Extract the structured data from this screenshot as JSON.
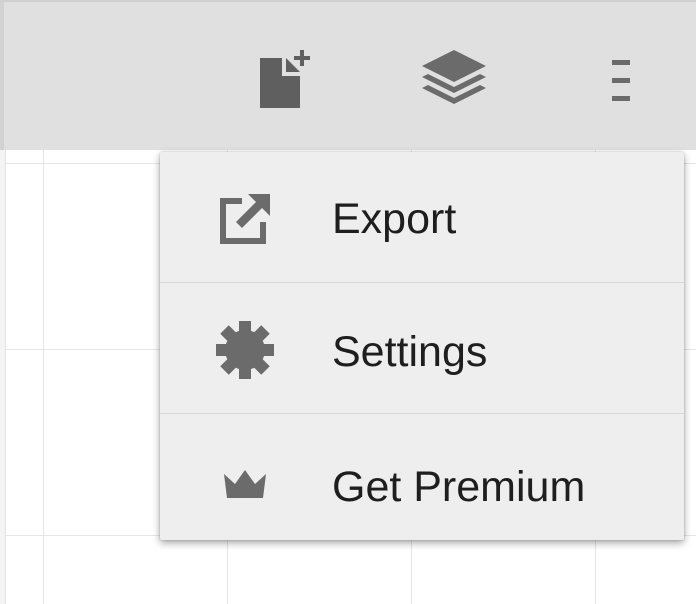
{
  "toolbar": {
    "buttons": [
      {
        "icon": "new-document-icon"
      },
      {
        "icon": "layers-icon"
      },
      {
        "icon": "overflow-menu-icon"
      }
    ]
  },
  "menu": {
    "items": [
      {
        "label": "Export",
        "icon": "export-icon"
      },
      {
        "label": "Settings",
        "icon": "gear-icon"
      },
      {
        "label": "Get Premium",
        "icon": "crown-icon"
      }
    ]
  },
  "colors": {
    "toolbar_bg": "#e0e0e0",
    "menu_bg": "#eeeeee",
    "icon": "#6b6b6b",
    "text": "#1e1e1e"
  }
}
